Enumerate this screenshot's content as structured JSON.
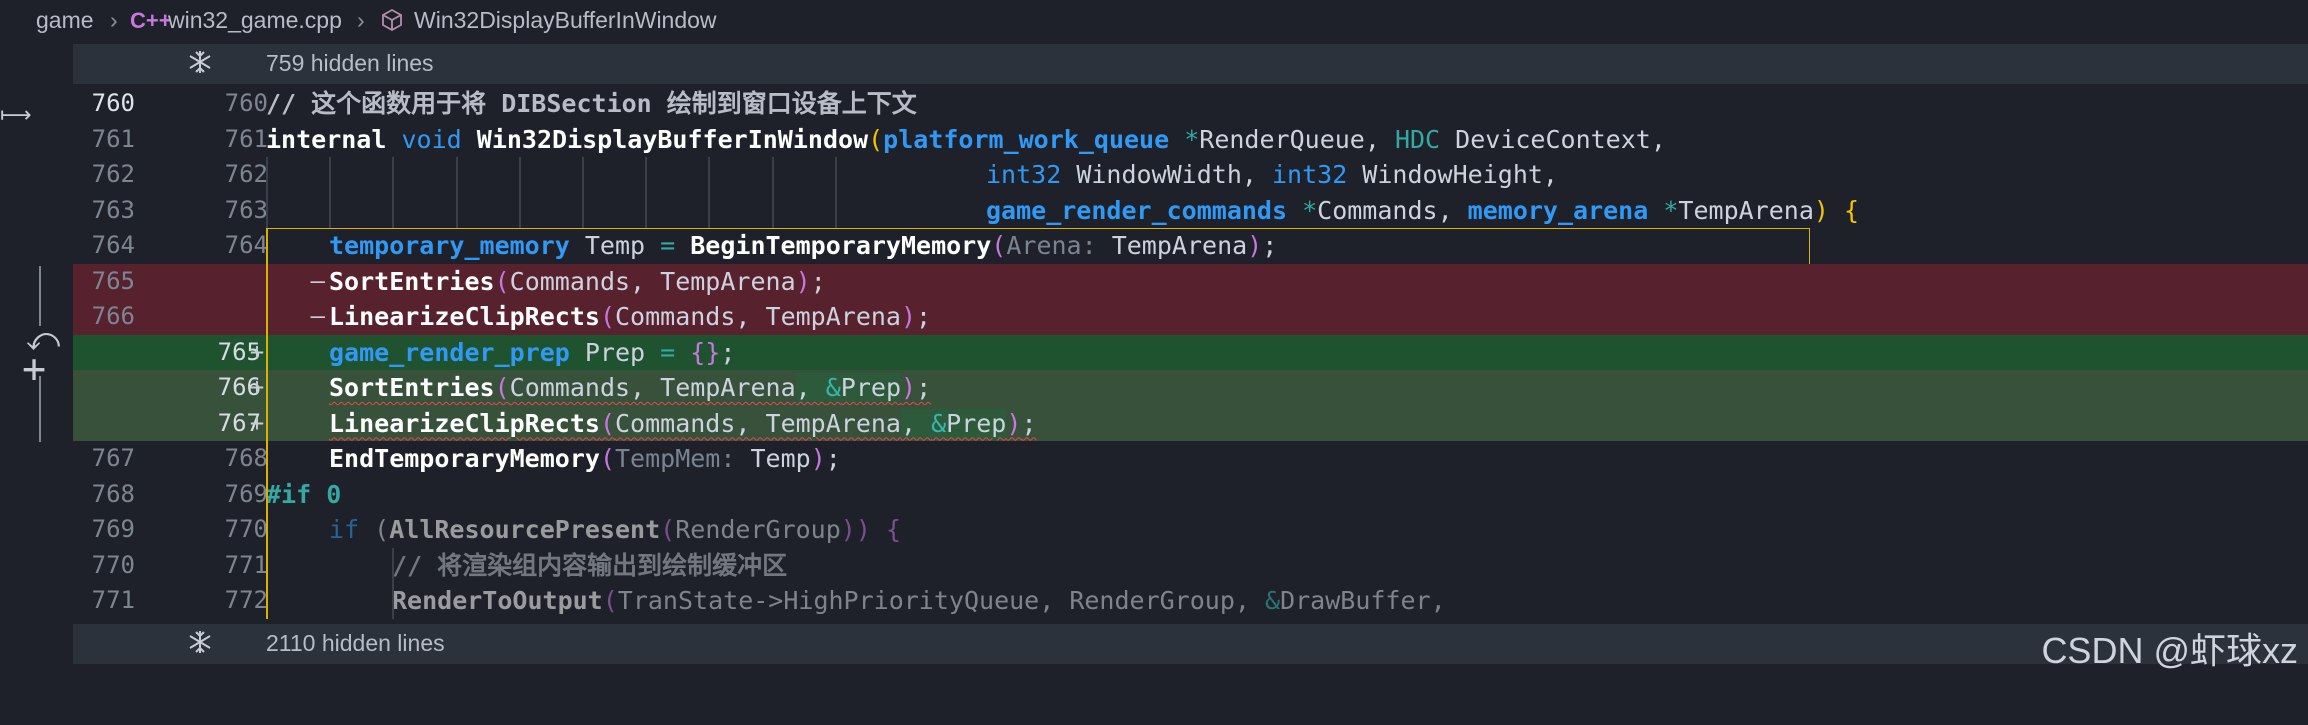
{
  "breadcrumb": {
    "folder": "game",
    "file_icon": "C++",
    "file": "win32_game.cpp",
    "symbol": "Win32DisplayBufferInWindow"
  },
  "folds": {
    "top": "759 hidden lines",
    "bottom": "2110 hidden lines"
  },
  "rows": [
    {
      "l1": "760",
      "l2": "760",
      "m": ""
    },
    {
      "l1": "761",
      "l2": "761",
      "m": ""
    },
    {
      "l1": "762",
      "l2": "762",
      "m": ""
    },
    {
      "l1": "763",
      "l2": "763",
      "m": ""
    },
    {
      "l1": "764",
      "l2": "764",
      "m": ""
    },
    {
      "l1": "765",
      "l2": "",
      "m": "—"
    },
    {
      "l1": "766",
      "l2": "",
      "m": "—"
    },
    {
      "l1": "",
      "l2": "765",
      "m": "+"
    },
    {
      "l1": "",
      "l2": "766",
      "m": "+"
    },
    {
      "l1": "",
      "l2": "767",
      "m": "+"
    },
    {
      "l1": "767",
      "l2": "768",
      "m": ""
    },
    {
      "l1": "768",
      "l2": "769",
      "m": ""
    },
    {
      "l1": "769",
      "l2": "770",
      "m": ""
    },
    {
      "l1": "770",
      "l2": "771",
      "m": ""
    },
    {
      "l1": "771",
      "l2": "772",
      "m": ""
    }
  ],
  "code": {
    "r0": {
      "comment": "// 这个函数用于将 DIBSection 绘制到窗口设备上下文"
    },
    "r1": {
      "kw_internal": "internal",
      "kw_void": "void",
      "fn": "Win32DisplayBufferInWindow",
      "p_open": "(",
      "t1": "platform_work_queue",
      "star1": "*",
      "a1": "RenderQueue, ",
      "t2": "HDC",
      "a2": " DeviceContext,"
    },
    "r2": {
      "t1": "int32",
      "a1": " WindowWidth, ",
      "t2": "int32",
      "a2": " WindowHeight,"
    },
    "r3": {
      "t1": "game_render_commands",
      "star1": "*",
      "a1": "Commands, ",
      "t2": "memory_arena",
      "star2": "*",
      "a2": "TempArena",
      "close": ")",
      "brace": " {"
    },
    "r4": {
      "t1": "temporary_memory",
      "a1": " Temp ",
      "eq": "=",
      "fn": " BeginTemporaryMemory",
      "p": "(",
      "hint": "Arena:",
      "a2": " TempArena",
      "pc": ")",
      "semi": ";"
    },
    "r5": {
      "fn": "SortEntries",
      "p": "(",
      "a": "Commands, TempArena",
      "pc": ")",
      "semi": ";"
    },
    "r6": {
      "fn": "LinearizeClipRects",
      "p": "(",
      "a": "Commands, TempArena",
      "pc": ")",
      "semi": ";"
    },
    "r7": {
      "t1": "game_render_prep",
      "a1": " Prep ",
      "eq": "=",
      "br": " {}",
      "semi": ";"
    },
    "r8": {
      "fn": "SortEntries",
      "p": "(",
      "a": "Commands, TempArena",
      "sep": ", ",
      "amp": "&",
      "a2": "Prep",
      "pc": ")",
      "semi": ";"
    },
    "r9": {
      "fn": "LinearizeClipRects",
      "p": "(",
      "a": "Commands, TempArena",
      "sep": ", ",
      "amp": "&",
      "a2": "Prep",
      "pc": ")",
      "semi": ";"
    },
    "r10": {
      "fn": "EndTemporaryMemory",
      "p": "(",
      "hint": "TempMem:",
      "a": " Temp",
      "pc": ")",
      "semi": ";"
    },
    "r11": {
      "pre": "#if",
      "num": " 0"
    },
    "r12": {
      "kw": "if",
      "p": " (",
      "fn": "AllResourcePresent",
      "p2": "(",
      "a": "RenderGroup",
      "pc": "))",
      "brace": " {"
    },
    "r13": {
      "comment": "// 将渲染组内容输出到绘制缓冲区"
    },
    "r14": {
      "fn": "RenderToOutput",
      "p": "(",
      "a": "TranState->HighPriorityQueue, RenderGroup, ",
      "amp": "&",
      "a2": "DrawBuffer,"
    }
  },
  "watermark": "CSDN @虾球xz"
}
